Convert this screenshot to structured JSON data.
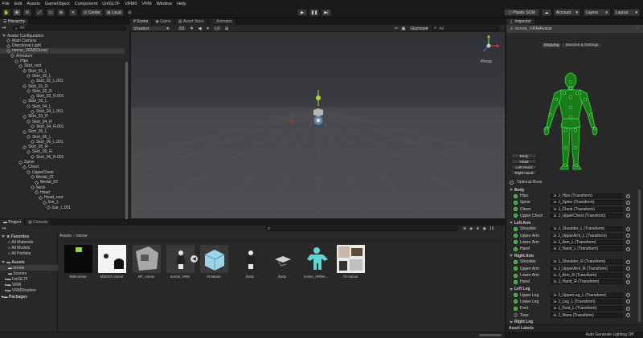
{
  "menu": [
    "File",
    "Edit",
    "Assets",
    "GameObject",
    "Component",
    "UniGLTF",
    "VRM0",
    "VRM",
    "Window",
    "Help"
  ],
  "toolbar": {
    "center": "Center",
    "local": "Local",
    "plastic": "Plastic SCM",
    "account": "Account",
    "layers": "Layers",
    "layout": "Layout"
  },
  "hierarchy": {
    "tab": "Hierarchy",
    "search_placeholder": "All",
    "items": [
      {
        "label": "Avatar Configuration",
        "depth": 0,
        "kind": "scene"
      },
      {
        "label": "Main Camera",
        "depth": 1,
        "kind": "obj"
      },
      {
        "label": "Directional Light",
        "depth": 1,
        "kind": "obj"
      },
      {
        "label": "nonne_VRM(Clone)",
        "depth": 1,
        "kind": "obj",
        "selected": true
      },
      {
        "label": "Armature",
        "depth": 2,
        "kind": "obj"
      },
      {
        "label": "Hips",
        "depth": 3,
        "kind": "obj"
      },
      {
        "label": "Skirt_root",
        "depth": 4,
        "kind": "obj"
      },
      {
        "label": "Skirt_01_L",
        "depth": 5,
        "kind": "obj"
      },
      {
        "label": "Skirt_02_L",
        "depth": 6,
        "kind": "obj"
      },
      {
        "label": "Skirt_02_L.001",
        "depth": 7,
        "kind": "obj"
      },
      {
        "label": "Skirt_01_R",
        "depth": 5,
        "kind": "obj"
      },
      {
        "label": "Skirt_02_R",
        "depth": 6,
        "kind": "obj"
      },
      {
        "label": "Skirt_02_R.001",
        "depth": 7,
        "kind": "obj"
      },
      {
        "label": "Skirt_03_L",
        "depth": 5,
        "kind": "obj"
      },
      {
        "label": "Skirt_04_L",
        "depth": 6,
        "kind": "obj"
      },
      {
        "label": "Skirt_04_L.001",
        "depth": 7,
        "kind": "obj"
      },
      {
        "label": "Skirt_03_R",
        "depth": 5,
        "kind": "obj"
      },
      {
        "label": "Skirt_04_R",
        "depth": 6,
        "kind": "obj"
      },
      {
        "label": "Skirt_04_R.001",
        "depth": 7,
        "kind": "obj"
      },
      {
        "label": "Skirt_05_L",
        "depth": 5,
        "kind": "obj"
      },
      {
        "label": "Skirt_06_L",
        "depth": 6,
        "kind": "obj"
      },
      {
        "label": "Skirt_06_L.001",
        "depth": 7,
        "kind": "obj"
      },
      {
        "label": "Skirt_05_R",
        "depth": 5,
        "kind": "obj"
      },
      {
        "label": "Skirt_06_R",
        "depth": 6,
        "kind": "obj"
      },
      {
        "label": "Skirt_06_R.001",
        "depth": 7,
        "kind": "obj"
      },
      {
        "label": "Spine",
        "depth": 4,
        "kind": "obj"
      },
      {
        "label": "Chest",
        "depth": 5,
        "kind": "obj"
      },
      {
        "label": "UpperChest",
        "depth": 6,
        "kind": "obj"
      },
      {
        "label": "Medal_01",
        "depth": 7,
        "kind": "obj"
      },
      {
        "label": "Medal_02",
        "depth": 8,
        "kind": "obj"
      },
      {
        "label": "Neck",
        "depth": 7,
        "kind": "obj"
      },
      {
        "label": "Head",
        "depth": 8,
        "kind": "obj"
      },
      {
        "label": "Head_root",
        "depth": 9,
        "kind": "obj"
      },
      {
        "label": "Ear_L",
        "depth": 10,
        "kind": "obj"
      },
      {
        "label": "Ear_L.001",
        "depth": 11,
        "kind": "obj"
      }
    ]
  },
  "scene": {
    "tabs": [
      "Scene",
      "Game",
      "Asset Store",
      "Animator"
    ],
    "shading": "Shaded",
    "mode2d": "2D",
    "gizmos": "Gizmos",
    "search_placeholder": "All",
    "persp": "Persp",
    "count": "0"
  },
  "project": {
    "tabs": [
      "Project",
      "Console"
    ],
    "count": "16",
    "favorites": {
      "label": "Favorites",
      "items": [
        "All Materials",
        "All Models",
        "All Prefabs"
      ]
    },
    "assets": {
      "label": "Assets",
      "items": [
        "nonne",
        "Scenes",
        "UniGLTF",
        "VRM",
        "VRMShaders"
      ]
    },
    "packages": "Packages",
    "breadcrumb": [
      "Assets",
      "nonne"
    ],
    "files": [
      {
        "label": "EMI-nonne",
        "kind": "emi"
      },
      {
        "label": "MSOUT-nonne",
        "kind": "msout"
      },
      {
        "label": "MT_nonne",
        "kind": "mt"
      },
      {
        "label": "nonne_VRM",
        "kind": "figure"
      },
      {
        "label": "Armature",
        "kind": "box"
      },
      {
        "label": "Body",
        "kind": "figure"
      },
      {
        "label": "Body",
        "kind": "mesh"
      },
      {
        "label": "nonne_VRMA...",
        "kind": "avatar"
      },
      {
        "label": "TX-nonne",
        "kind": "tex"
      }
    ]
  },
  "inspector": {
    "tab": "Inspector",
    "title": "nonne_VRMAvatar",
    "tabs": [
      "Mapping",
      "Muscles & Settings"
    ],
    "body_buttons": [
      "Body",
      "Head",
      "Left Hand",
      "Right Hand"
    ],
    "optional_bone": "Optional Bone",
    "sections": [
      {
        "label": "Body",
        "bones": [
          {
            "name": "Hips",
            "value": "J_Hips (Transform)",
            "on": true
          },
          {
            "name": "Spine",
            "value": "J_Spine (Transform)",
            "on": true
          },
          {
            "name": "Chest",
            "value": "J_Chest (Transform)",
            "on": true
          },
          {
            "name": "Upper Chest",
            "value": "J_UpperChest (Transform)",
            "on": true
          }
        ]
      },
      {
        "label": "Left Arm",
        "bones": [
          {
            "name": "Shoulder",
            "value": "J_Shoulder_L (Transform)",
            "on": true
          },
          {
            "name": "Upper Arm",
            "value": "J_UpperArm_L (Transform)",
            "on": true
          },
          {
            "name": "Lower Arm",
            "value": "J_Arm_L (Transform)",
            "on": true
          },
          {
            "name": "Hand",
            "value": "J_Hand_L (Transform)",
            "on": true
          }
        ]
      },
      {
        "label": "Right Arm",
        "bones": [
          {
            "name": "Shoulder",
            "value": "J_Shoulder_R (Transform)",
            "on": true
          },
          {
            "name": "Upper Arm",
            "value": "J_UpperArm_R (Transform)",
            "on": true
          },
          {
            "name": "Lower Arm",
            "value": "J_Arm_R (Transform)",
            "on": true
          },
          {
            "name": "Hand",
            "value": "J_Hand_R (Transform)",
            "on": true
          }
        ]
      },
      {
        "label": "Left Leg",
        "bones": [
          {
            "name": "Upper Leg",
            "value": "J_UpperLeg_L (Transform)",
            "on": true
          },
          {
            "name": "Lower Leg",
            "value": "J_Leg_L (Transform)",
            "on": true
          },
          {
            "name": "Foot",
            "value": "J_Foot_L (Transform)",
            "on": true
          },
          {
            "name": "Toes",
            "value": "J_None (Transform)",
            "on": false
          }
        ]
      },
      {
        "label": "Right Leg",
        "bones": []
      }
    ],
    "asset_labels": "Asset Labels"
  },
  "status": {
    "lighting": "Auto Generate Lighting Off"
  },
  "colors": {
    "accent": "#2c5d87",
    "bone_green": "#2bd12b"
  }
}
